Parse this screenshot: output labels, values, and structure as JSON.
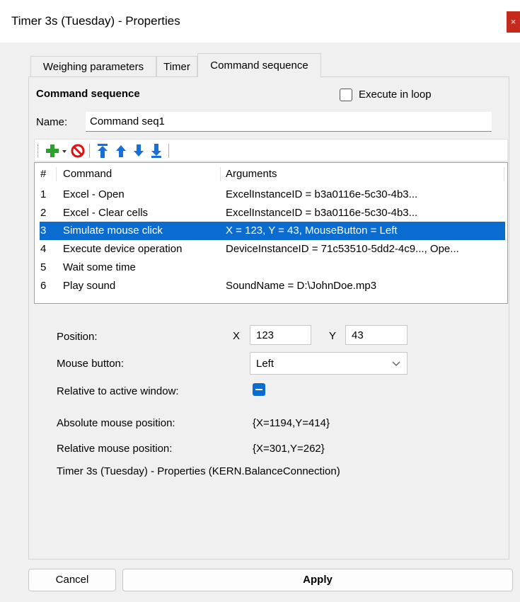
{
  "window": {
    "title": "Timer 3s (Tuesday) - Properties",
    "close_glyph": "×"
  },
  "tabs": [
    {
      "label": "Weighing parameters"
    },
    {
      "label": "Timer"
    },
    {
      "label": "Command sequence",
      "active": true
    }
  ],
  "section": {
    "title": "Command sequence",
    "loop_label": "Execute in loop",
    "loop_checked": false
  },
  "name": {
    "label": "Name:",
    "value": "Command seq1"
  },
  "toolbar": {
    "icons": [
      "add-icon",
      "dropdown-arrow-icon",
      "remove-icon",
      "move-top-icon",
      "move-up-icon",
      "move-down-icon",
      "move-bottom-icon"
    ],
    "colors": {
      "add": "#2e9e2e",
      "remove": "#e01010",
      "move": "#1a6fd6"
    }
  },
  "grid": {
    "headers": {
      "num": "#",
      "command": "Command",
      "arguments": "Arguments"
    },
    "rows": [
      {
        "num": "1",
        "command": "Excel - Open",
        "arguments": "ExcelInstanceID = b3a0116e-5c30-4b3..."
      },
      {
        "num": "2",
        "command": "Excel - Clear cells",
        "arguments": "ExcelInstanceID = b3a0116e-5c30-4b3..."
      },
      {
        "num": "3",
        "command": "Simulate mouse click",
        "arguments": "X = 123, Y = 43, MouseButton = Left",
        "selected": true
      },
      {
        "num": "4",
        "command": "Execute device operation",
        "arguments": "DeviceInstanceID = 71c53510-5dd2-4c9..., Ope..."
      },
      {
        "num": "5",
        "command": "Wait some time",
        "arguments": ""
      },
      {
        "num": "6",
        "command": "Play sound",
        "arguments": "SoundName = D:\\JohnDoe.mp3"
      }
    ],
    "selection_color": "#0a6cce"
  },
  "details": {
    "position_label": "Position:",
    "x_label": "X",
    "x_value": "123",
    "y_label": "Y",
    "y_value": "43",
    "mouse_button_label": "Mouse button:",
    "mouse_button_value": "Left",
    "relative_label": "Relative to active window:",
    "relative_checked": true,
    "absolute_label": "Absolute mouse position:",
    "absolute_value": "{X=1194,Y=414}",
    "relative_pos_label": "Relative mouse position:",
    "relative_pos_value": "{X=301,Y=262}",
    "description": "Timer 3s (Tuesday) - Properties (KERN.BalanceConnection)"
  },
  "buttons": {
    "cancel": "Cancel",
    "apply": "Apply"
  },
  "colors": {
    "accent": "#0a6cce",
    "close": "#c42b1c",
    "window_bg": "#f0f0f0"
  }
}
